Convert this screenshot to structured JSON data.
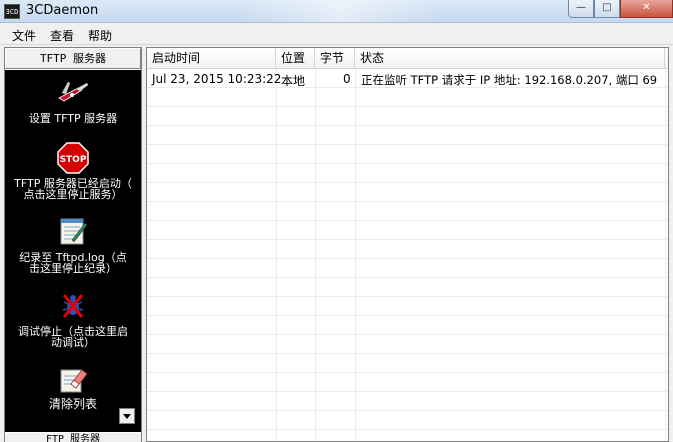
{
  "window": {
    "title": "3CDaemon",
    "icon_label": "3CD"
  },
  "menu": [
    "文件",
    "查看",
    "帮助"
  ],
  "sidebar": {
    "header": "TFTP 服务器",
    "footer": "FTP 服务器",
    "items": [
      {
        "label": "设置 TFTP 服务器",
        "icon": "pocket-knife-icon"
      },
      {
        "label": "TFTP 服务器已经启动（\n点击这里停止服务）",
        "icon": "stop-sign-icon"
      },
      {
        "label": "纪录至 Tftpd.log（点\n击这里停止纪录）",
        "icon": "log-notepad-icon"
      },
      {
        "label": "调试停止（点击这里启\n动调试）",
        "icon": "debug-bug-icon"
      },
      {
        "label": "清除列表",
        "icon": "eraser-icon"
      }
    ]
  },
  "list": {
    "columns": [
      "启动时间",
      "位置",
      "字节",
      "状态"
    ],
    "rows": [
      {
        "time": "Jul 23, 2015 10:23:22",
        "location": "本地",
        "bytes": "0",
        "status": "正在监听 TFTP 请求于 IP 地址: 192.168.0.207, 端口 69"
      }
    ]
  }
}
